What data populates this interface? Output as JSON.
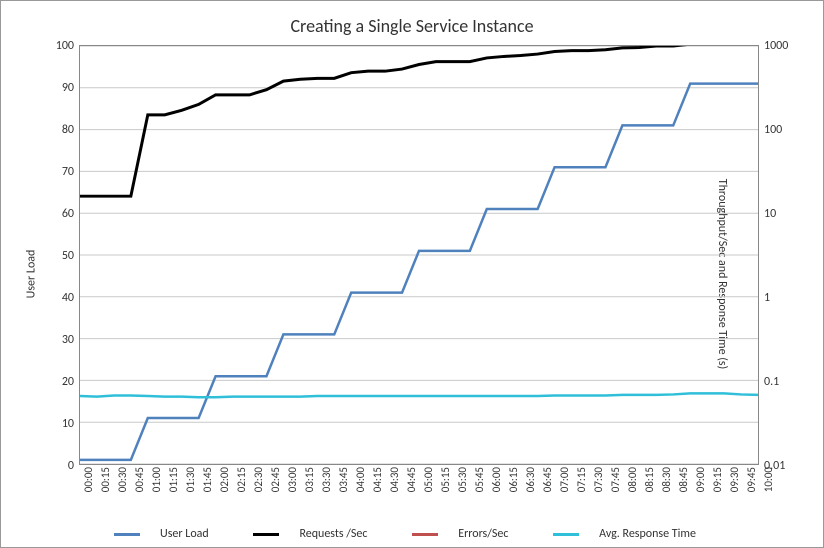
{
  "chart_data": {
    "type": "line",
    "title": "Creating a Single Service Instance",
    "xlabel": "",
    "ylabel_left": "User Load",
    "ylabel_right": "Throughput/Sec and Response Time (s)",
    "y_left": {
      "min": 0,
      "max": 100,
      "ticks": [
        0,
        10,
        20,
        30,
        40,
        50,
        60,
        70,
        80,
        90,
        100
      ]
    },
    "y_right": {
      "scale": "log",
      "min": 0.01,
      "max": 1000,
      "ticks": [
        0.01,
        0.1,
        1,
        10,
        100,
        1000
      ]
    },
    "categories": [
      "00:00",
      "00:15",
      "00:30",
      "00:45",
      "01:00",
      "01:15",
      "01:30",
      "01:45",
      "02:00",
      "02:15",
      "02:30",
      "02:45",
      "03:00",
      "03:15",
      "03:30",
      "03:45",
      "04:00",
      "04:15",
      "04:30",
      "04:45",
      "05:00",
      "05:15",
      "05:30",
      "05:45",
      "06:00",
      "06:15",
      "06:30",
      "06:45",
      "07:00",
      "07:15",
      "07:30",
      "07:45",
      "08:00",
      "08:15",
      "08:30",
      "08:45",
      "09:00",
      "09:15",
      "09:30",
      "09:45",
      "10:00"
    ],
    "series": [
      {
        "name": "User Load",
        "axis": "left",
        "color": "#4f81bd",
        "values": [
          1,
          1,
          1,
          1,
          11,
          11,
          11,
          11,
          21,
          21,
          21,
          21,
          31,
          31,
          31,
          31,
          41,
          41,
          41,
          41,
          51,
          51,
          51,
          51,
          61,
          61,
          61,
          61,
          71,
          71,
          71,
          71,
          81,
          81,
          81,
          81,
          91,
          91,
          91,
          91,
          91
        ]
      },
      {
        "name": "Requests /Sec",
        "axis": "right",
        "color": "#000000",
        "values": [
          16,
          16,
          16,
          16,
          150,
          150,
          170,
          200,
          260,
          260,
          260,
          300,
          380,
          400,
          410,
          410,
          480,
          500,
          500,
          530,
          600,
          650,
          650,
          650,
          720,
          750,
          770,
          800,
          860,
          880,
          880,
          900,
          950,
          960,
          1000,
          1000,
          1050,
          1120,
          1120,
          1120,
          1150
        ]
      },
      {
        "name": "Errors/Sec",
        "axis": "right",
        "color": "#c0504d",
        "values": [
          null,
          null,
          null,
          null,
          null,
          null,
          null,
          null,
          null,
          null,
          null,
          null,
          null,
          null,
          null,
          null,
          null,
          null,
          null,
          null,
          null,
          null,
          null,
          null,
          null,
          null,
          null,
          null,
          null,
          null,
          null,
          null,
          null,
          null,
          null,
          null,
          null,
          null,
          null,
          null,
          null
        ]
      },
      {
        "name": "Avg. Response Time",
        "axis": "right",
        "color": "#2fbfd9",
        "values": [
          0.065,
          0.064,
          0.066,
          0.066,
          0.065,
          0.064,
          0.064,
          0.063,
          0.063,
          0.064,
          0.064,
          0.064,
          0.064,
          0.064,
          0.065,
          0.065,
          0.065,
          0.065,
          0.065,
          0.065,
          0.065,
          0.065,
          0.065,
          0.065,
          0.065,
          0.065,
          0.065,
          0.065,
          0.066,
          0.066,
          0.066,
          0.066,
          0.067,
          0.067,
          0.067,
          0.068,
          0.07,
          0.07,
          0.07,
          0.068,
          0.067
        ]
      }
    ],
    "legend": [
      "User Load",
      "Requests /Sec",
      "Errors/Sec",
      "Avg. Response Time"
    ]
  }
}
